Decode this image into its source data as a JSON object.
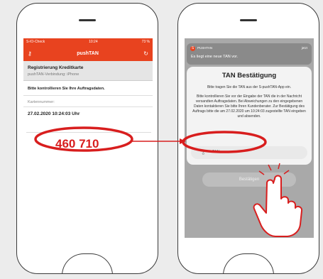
{
  "left_phone": {
    "status": {
      "carrier": "S-IO-Check",
      "time": "10:24",
      "battery": "73 %"
    },
    "app_bar": {
      "title": "pushTAN",
      "left_icon": "key-icon",
      "right_icon": "refresh-icon"
    },
    "registration": {
      "title": "Registrierung Kreditkarte",
      "connection": "pushTAN-Verbindung: iPhone"
    },
    "check_text": "Bitte kontrollieren Sie Ihre Auftragsdaten.",
    "card_label": "Kartennummer:",
    "datetime": "27.02.2020 10:24:03 Uhr",
    "tan": "460 710"
  },
  "right_phone": {
    "notification": {
      "app": "PUSHTAN",
      "time": "jetzt",
      "text": "Es liegt eine neue TAN vor."
    },
    "dialog": {
      "title": "TAN Bestätigung",
      "text1": "Bitte tragen Sie die TAN aus der S-pushTAN-App ein.",
      "text2": "Bitte kontrollieren Sie vor der Eingabe der TAN die in der Nachricht versandten Auftragsdaten. Bei Abweichungen zu den eingegebenen Daten kontaktieren Sie bitte Ihren Kundenberater. Zur Bestätigung des Auftrags bitte die am 27.02.2020 um 10:24:03 zugestellte TAN eingeben und absenden.",
      "input_placeholder": "TAN"
    },
    "confirm_label": "Bestätigen"
  },
  "colors": {
    "accent": "#e8431f",
    "highlight": "#d81e1e"
  }
}
